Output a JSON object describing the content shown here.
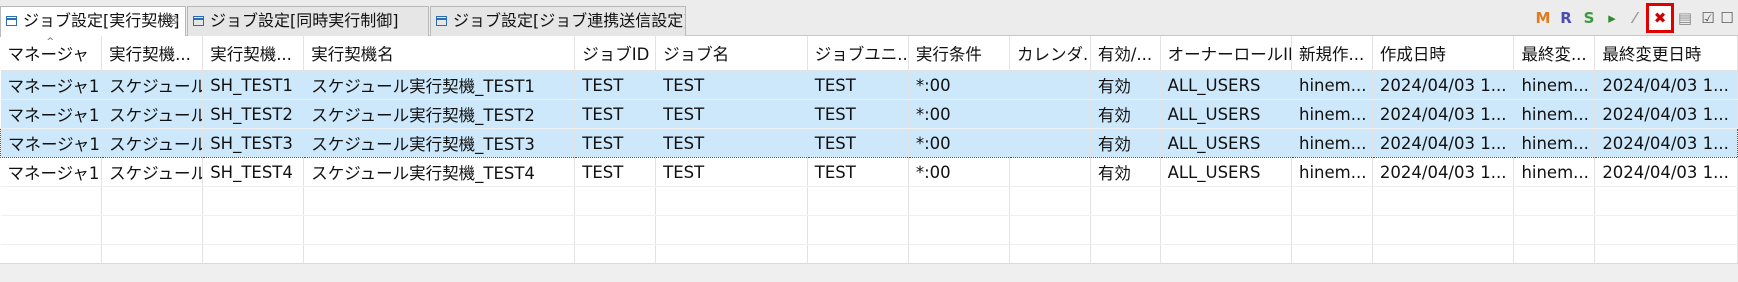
{
  "tabs": [
    {
      "label": "ジョブ設定[実行契機]",
      "close": "⊗",
      "active": true
    },
    {
      "label": "ジョブ設定[同時実行制御]",
      "active": false
    },
    {
      "label": "ジョブ設定[ジョブ連携送信設定]",
      "active": false
    }
  ],
  "toolbar": {
    "buttons": [
      {
        "name": "add-icon",
        "glyph": "M",
        "color": "#e07b1f"
      },
      {
        "name": "modify-icon",
        "glyph": "R",
        "color": "#4b4bb3"
      },
      {
        "name": "copy-icon",
        "glyph": "S",
        "color": "#3c9a3c"
      },
      {
        "name": "run-icon",
        "glyph": "▸",
        "color": "#2e8b2e"
      },
      {
        "name": "edit-icon",
        "glyph": "⁄",
        "color": "#9a9a9a"
      },
      {
        "name": "delete-icon",
        "glyph": "✖",
        "color": "#d00000"
      },
      {
        "name": "document-icon",
        "glyph": "▤",
        "color": "#8a8a8a"
      },
      {
        "name": "checked-icon",
        "glyph": "☑",
        "color": "#5a5a5a"
      },
      {
        "name": "unchecked-icon",
        "glyph": "☐",
        "color": "#5a5a5a"
      }
    ]
  },
  "table": {
    "headers": [
      "マネージャ",
      "実行契機...",
      "実行契機...",
      "実行契機名",
      "ジョブID",
      "ジョブ名",
      "ジョブユニ...",
      "実行条件",
      "カレンダ...",
      "有効/...",
      "オーナーロールID",
      "新規作...",
      "作成日時",
      "最終変...",
      "最終変更日時"
    ],
    "rows": [
      {
        "cells": [
          "マネージャ1",
          "スケジュール",
          "SH_TEST1",
          "スケジュール実行契機_TEST1",
          "TEST",
          "TEST",
          "TEST",
          "*:00",
          "",
          "有効",
          "ALL_USERS",
          "hinem...",
          "2024/04/03 1...",
          "hinem...",
          "2024/04/03 1..."
        ],
        "state": "selected"
      },
      {
        "cells": [
          "マネージャ1",
          "スケジュール",
          "SH_TEST2",
          "スケジュール実行契機_TEST2",
          "TEST",
          "TEST",
          "TEST",
          "*:00",
          "",
          "有効",
          "ALL_USERS",
          "hinem...",
          "2024/04/03 1...",
          "hinem...",
          "2024/04/03 1..."
        ],
        "state": "selected"
      },
      {
        "cells": [
          "マネージャ1",
          "スケジュール",
          "SH_TEST3",
          "スケジュール実行契機_TEST3",
          "TEST",
          "TEST",
          "TEST",
          "*:00",
          "",
          "有効",
          "ALL_USERS",
          "hinem...",
          "2024/04/03 1...",
          "hinem...",
          "2024/04/03 1..."
        ],
        "state": "selected-focused"
      },
      {
        "cells": [
          "マネージャ1",
          "スケジュール",
          "SH_TEST4",
          "スケジュール実行契機_TEST4",
          "TEST",
          "TEST",
          "TEST",
          "*:00",
          "",
          "有効",
          "ALL_USERS",
          "hinem...",
          "2024/04/03 1...",
          "hinem...",
          "2024/04/03 1..."
        ],
        "state": "normal"
      }
    ],
    "empty_rows": 3
  },
  "colors": {
    "selection": "#cde8fb",
    "highlight_border": "#e00000",
    "tab_icon": "#2d6db5"
  }
}
